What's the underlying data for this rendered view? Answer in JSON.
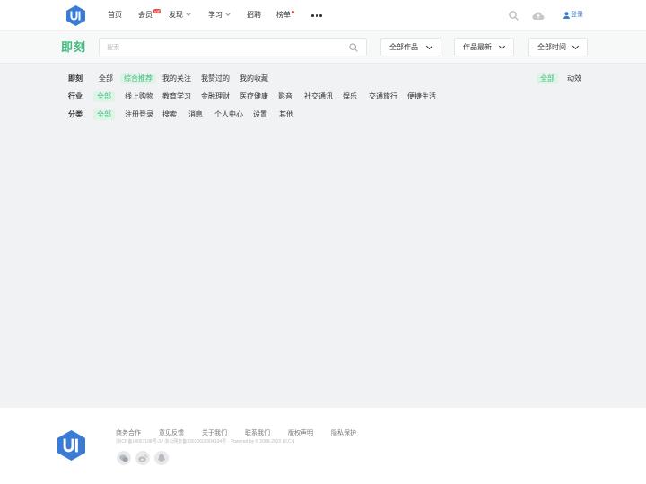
{
  "nav": {
    "items": [
      {
        "label": "首页"
      },
      {
        "label": "会员",
        "badge": "VIP"
      },
      {
        "label": "发现"
      },
      {
        "label": "学习"
      },
      {
        "label": "招聘"
      },
      {
        "label": "榜单"
      }
    ],
    "login_label": "登录"
  },
  "header": {
    "brand": "即刻",
    "search_placeholder": "搜索",
    "dropdowns": [
      "全部作品",
      "作品最新",
      "全部时间"
    ]
  },
  "filters": {
    "row1": {
      "label": "即刻",
      "chips": [
        "全部",
        "综合推荐",
        "我的关注",
        "我赞过的",
        "我的收藏"
      ],
      "right_chips": [
        "全部",
        "动效"
      ]
    },
    "row2": {
      "label": "行业",
      "chips": [
        "全部",
        "线上购物",
        "教育学习",
        "金融理财",
        "医疗健康",
        "影音",
        "社交通讯",
        "娱乐",
        "交通旅行",
        "便捷生活"
      ]
    },
    "row3": {
      "label": "分类",
      "chips": [
        "全部",
        "注册登录",
        "搜索",
        "消息",
        "个人中心",
        "设置",
        "其他"
      ]
    }
  },
  "footer": {
    "links": [
      "商务合作",
      "意见反馈",
      "关于我们",
      "联系我们",
      "版权声明",
      "隐私保护"
    ],
    "copyright": "浙ICP备14007108号-3 / 浙公网安备33010602004104号 · Powered by © 2008-2020 UI.CN"
  },
  "colors": {
    "accent_green": "#3dbd7d",
    "brand_blue": "#3a7bd5",
    "badge_red": "#e84c3d"
  }
}
